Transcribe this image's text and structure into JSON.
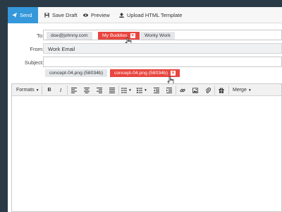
{
  "toolbar": {
    "send_label": "Send",
    "save_draft_label": "Save Draft",
    "preview_label": "Preview",
    "upload_label": "Upload HTML Template"
  },
  "fields": {
    "to_label": "To:",
    "from_label": "From:",
    "subject_label": "Subject:",
    "from_value": "Work Email",
    "subject_value": ""
  },
  "recipients": [
    {
      "label": "doe@johnny.com",
      "selected": false
    },
    {
      "label": "My Buddies",
      "selected": true
    },
    {
      "label": "Worky Work",
      "selected": false
    }
  ],
  "attachments": [
    {
      "label": "concept-04.png (58034b)",
      "selected": false
    },
    {
      "label": "concept-04.png (58034b)",
      "selected": true
    }
  ],
  "editor": {
    "formats_label": "Formats",
    "merge_label": "Merge",
    "bold_label": "B",
    "italic_label": "I"
  },
  "colors": {
    "accent": "#3498db",
    "tag_selected": "#e8463f",
    "background": "#2b3a47"
  }
}
